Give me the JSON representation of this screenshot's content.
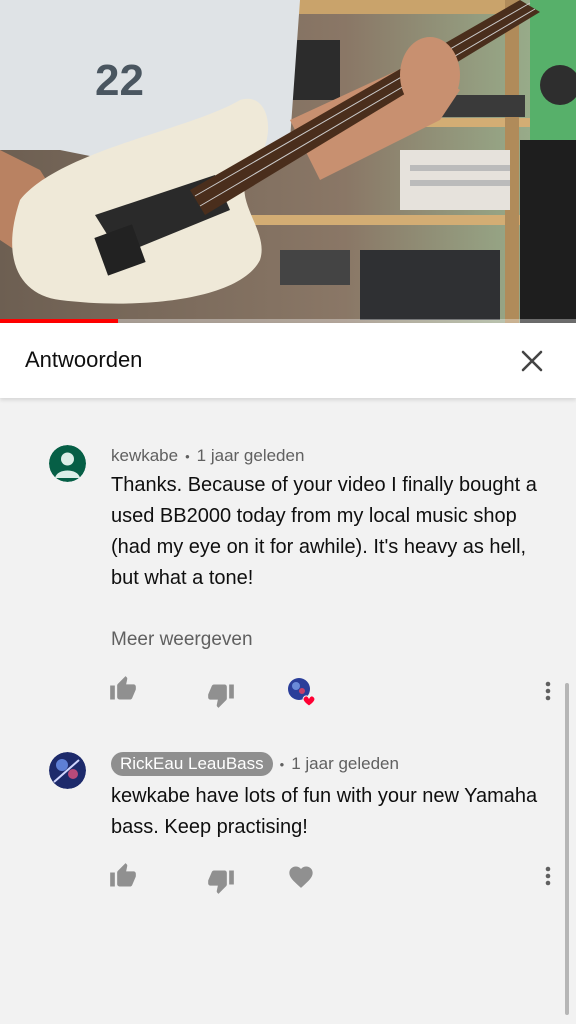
{
  "panel": {
    "title": "Antwoorden",
    "close_icon": "close-icon"
  },
  "video": {
    "progress_fraction": 0.205,
    "progress_color": "#ff0000"
  },
  "comments": [
    {
      "author": "kewkabe",
      "time": "1 jaar geleden",
      "text": "Thanks. Because of your video I finally bought a used BB2000 today from my local music shop (had my eye on it for awhile). It's heavy as hell, but what a tone!",
      "more_label": "Meer weergeven",
      "avatar_color": "#065f46",
      "hearted_by_creator": true,
      "author_is_creator": false
    },
    {
      "author": "RickEau LeauBass",
      "time": "1 jaar geleden",
      "text": "kewkabe have lots of fun with your new Yamaha bass. Keep practising!",
      "hearted_by_creator": false,
      "author_is_creator": true
    }
  ],
  "colors": {
    "background": "#f2f2f2",
    "header_bg": "#ffffff",
    "secondary_text": "#606060",
    "icon": "#909090",
    "creator_chip": "#8f8f8f",
    "heart": "#ff0033"
  }
}
